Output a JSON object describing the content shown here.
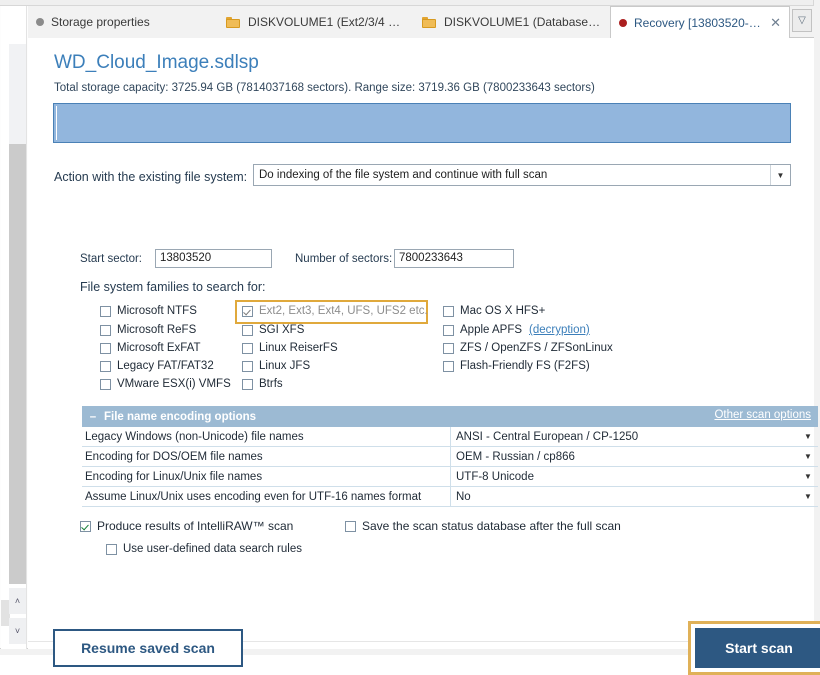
{
  "tabs": [
    {
      "label": "Storage properties",
      "icon": "gray-dot-icon",
      "active": false
    },
    {
      "label": "DISKVOLUME1 (Ext2/3/4 at ...",
      "icon": "folder-icon",
      "active": false
    },
    {
      "label": "DISKVOLUME1 (Database at...",
      "icon": "folder-icon",
      "active": false
    },
    {
      "label": "Recovery [13803520-781...",
      "icon": "red-dot-icon",
      "active": true,
      "close": "✕"
    }
  ],
  "tab_list_button": "▽",
  "page": {
    "title": "WD_Cloud_Image.sdlsp",
    "capacity_line": "Total storage capacity: 3725.94 GB (7814037168 sectors). Range size: 3719.36 GB (7800233643 sectors)"
  },
  "action": {
    "label": "Action with the existing file system:",
    "value": "Do indexing of the file system and continue with full scan",
    "arrow": "▼"
  },
  "sectors": {
    "start_label": "Start sector:",
    "start_value": "13803520",
    "count_label": "Number of sectors:",
    "count_value": "7800233643"
  },
  "fs_families": {
    "label": "File system families to search for:",
    "column1": [
      {
        "label": "Microsoft NTFS",
        "checked": false
      },
      {
        "label": "Microsoft ReFS",
        "checked": false
      },
      {
        "label": "Microsoft ExFAT",
        "checked": false
      },
      {
        "label": "Legacy FAT/FAT32",
        "checked": false
      },
      {
        "label": "VMware ESX(i) VMFS",
        "checked": false
      }
    ],
    "column2": [
      {
        "label": "Ext2, Ext3, Ext4, UFS, UFS2 etc.",
        "checked": true,
        "dim": true,
        "highlighted": true
      },
      {
        "label": "SGI XFS",
        "checked": false
      },
      {
        "label": "Linux ReiserFS",
        "checked": false
      },
      {
        "label": "Linux JFS",
        "checked": false
      },
      {
        "label": "Btrfs",
        "checked": false
      }
    ],
    "column3": [
      {
        "label": "Mac OS X HFS+",
        "checked": false
      },
      {
        "label": "Apple APFS",
        "checked": false,
        "link": "(decryption)"
      },
      {
        "label": "ZFS / OpenZFS / ZFSonLinux",
        "checked": false
      },
      {
        "label": "Flash-Friendly FS (F2FS)",
        "checked": false
      }
    ]
  },
  "encoding_panel": {
    "collapse_glyph": "–",
    "title": "File name encoding options",
    "other_scan_options": "Other scan options",
    "arrow": "▼",
    "rows": [
      {
        "name": "Legacy Windows (non-Unicode) file names",
        "value": "ANSI - Central European / CP-1250"
      },
      {
        "name": "Encoding for DOS/OEM file names",
        "value": "OEM - Russian / cp866"
      },
      {
        "name": "Encoding for Linux/Unix file names",
        "value": "UTF-8 Unicode"
      },
      {
        "name": "Assume Linux/Unix uses encoding even for UTF-16 names format",
        "value": "No"
      }
    ]
  },
  "scan_options": {
    "intelliraw": {
      "label": "Produce results of IntelliRAW™ scan",
      "checked": true
    },
    "save_db": {
      "label": "Save the scan status database after the full scan",
      "checked": false
    },
    "user_rules": {
      "label": "Use user-defined data search rules",
      "checked": false
    }
  },
  "buttons": {
    "resume": "Resume saved scan",
    "start": "Start scan"
  },
  "scrollbar": {
    "up_arrow": "˄",
    "down_arrow": "˅"
  },
  "colors": {
    "accent_blue": "#3c7fba",
    "button_blue": "#2d5882",
    "highlight_gold": "#e0a93c",
    "panel_header": "#9cbad3",
    "partition_fill": "#92b6dd"
  }
}
